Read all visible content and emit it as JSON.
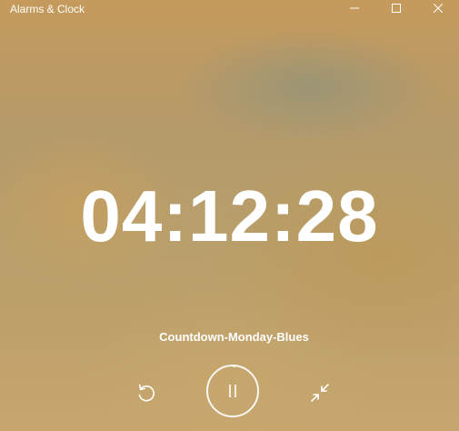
{
  "window": {
    "title": "Alarms & Clock",
    "controls": {
      "minimize_icon": "minimize-icon",
      "maximize_icon": "maximize-icon",
      "close_icon": "close-icon"
    }
  },
  "timer": {
    "time": "04:12:28",
    "name": "Countdown-Monday-Blues",
    "progress": 0.02
  },
  "controls": {
    "reset_icon": "reset-icon",
    "pause_icon": "pause-icon",
    "compact_icon": "collapse-icon"
  },
  "colors": {
    "text": "#ffffff",
    "background": "#c0a06a"
  }
}
